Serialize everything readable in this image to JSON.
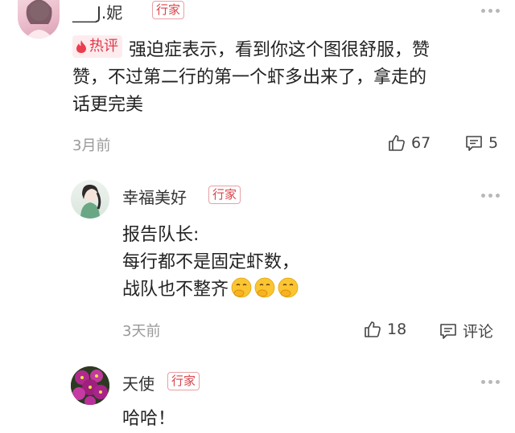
{
  "comments": [
    {
      "username": "___J.妮",
      "badge": "行家",
      "hot_label": "热评",
      "text_lines": [
        "强迫症表示，看到你这个图很舒服，赞",
        "赞，不过第二行的第一个虾多出来了，拿走的",
        "话更完美"
      ],
      "time": "3月前",
      "likes": "67",
      "replies": "5"
    },
    {
      "username": "幸福美好",
      "badge": "行家",
      "text_lines": [
        "报告队长:",
        "每行都不是固定虾数，",
        "战队也不整齐"
      ],
      "emoji": "face-with-hand-over-mouth",
      "time": "3天前",
      "likes": "18",
      "reply_label": "评论"
    },
    {
      "username": "天使",
      "badge": "行家",
      "text_lines": [
        "哈哈！"
      ]
    }
  ],
  "colors": {
    "badge_red": "#d9434a",
    "hot_bg": "#fdecee",
    "hot_text": "#e0384a",
    "meta_gray": "#999999"
  }
}
